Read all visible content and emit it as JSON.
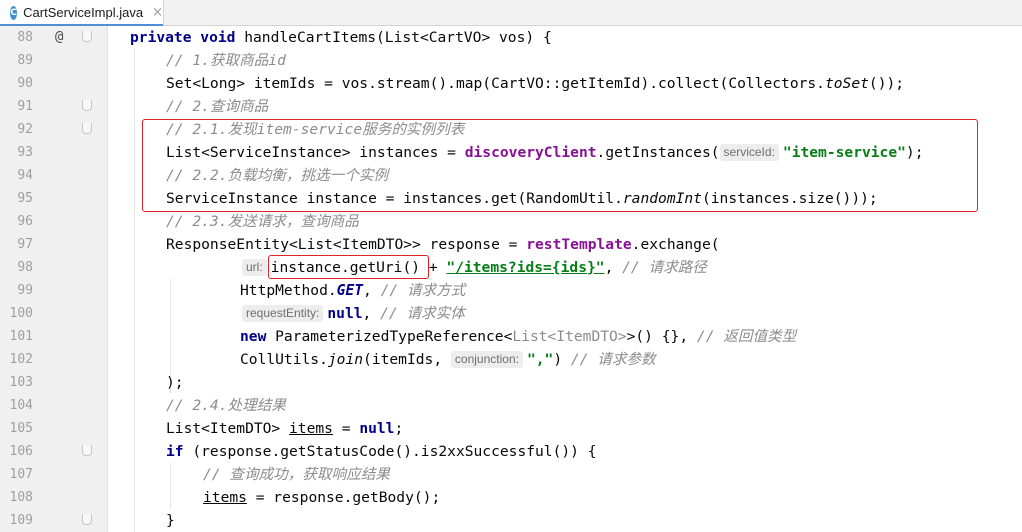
{
  "tab": {
    "icon": "C",
    "filename": "CartServiceImpl.java",
    "close": "×"
  },
  "gutter_marks": {
    "override": "@"
  },
  "hints": {
    "serviceId": "serviceId:",
    "url": "url:",
    "requestEntity": "requestEntity:",
    "conjunction": "conjunction:"
  },
  "lines": [
    {
      "num": "88"
    },
    {
      "num": "89"
    },
    {
      "num": "90"
    },
    {
      "num": "91"
    },
    {
      "num": "92"
    },
    {
      "num": "93"
    },
    {
      "num": "94"
    },
    {
      "num": "95"
    },
    {
      "num": "96"
    },
    {
      "num": "97"
    },
    {
      "num": "98"
    },
    {
      "num": "99"
    },
    {
      "num": "100"
    },
    {
      "num": "101"
    },
    {
      "num": "102"
    },
    {
      "num": "103"
    },
    {
      "num": "104"
    },
    {
      "num": "105"
    },
    {
      "num": "106"
    },
    {
      "num": "107"
    },
    {
      "num": "108"
    },
    {
      "num": "109"
    }
  ],
  "code": {
    "l88": {
      "kw1": "private void",
      "rest": " handleCartItems(List<CartVO> vos) {"
    },
    "l89": {
      "comment": "// 1.获取商品id"
    },
    "l90": {
      "a": "Set<Long> itemIds = vos.stream().map(CartVO::getItemId).collect(Collectors.",
      "it": "toSet",
      "b": "());"
    },
    "l91": {
      "comment": "// 2.查询商品"
    },
    "l92": {
      "comment": "// 2.1.发现item-service服务的实例列表"
    },
    "l93": {
      "a": "List<ServiceInstance> instances = ",
      "field": "discoveryClient",
      "b": ".getInstances(",
      "str": "\"item-service\"",
      "c": ");"
    },
    "l94": {
      "comment": "// 2.2.负载均衡，挑选一个实例"
    },
    "l95": {
      "a": "ServiceInstance instance = instances.get(RandomUtil.",
      "it": "randomInt",
      "b": "(instances.size()));"
    },
    "l96": {
      "comment": "// 2.3.发送请求，查询商品"
    },
    "l97": {
      "a": "ResponseEntity<List<ItemDTO>> response = ",
      "field": "restTemplate",
      "b": ".exchange("
    },
    "l98": {
      "a": "instance.getUri()",
      "b": " + ",
      "str": "\"/items?ids={ids}\"",
      "c": ", ",
      "comment": "// 请求路径"
    },
    "l99": {
      "a": "HttpMethod.",
      "it": "GET",
      "b": ", ",
      "comment": "// 请求方式"
    },
    "l100": {
      "kw": "null",
      "b": ", ",
      "comment": "// 请求实体"
    },
    "l101": {
      "kw": "new",
      "a": " ParameterizedTypeReference<",
      "grey": "List<ItemDTO>",
      "b": ">() {}, ",
      "comment": "// 返回值类型"
    },
    "l102": {
      "a": "CollUtils.",
      "it": "join",
      "b": "(itemIds, ",
      "str": "\",\"",
      "c": ") ",
      "comment": "// 请求参数"
    },
    "l103": {
      "a": ");"
    },
    "l104": {
      "comment": "// 2.4.处理结果"
    },
    "l105": {
      "a": "List<ItemDTO> ",
      "und": "items",
      "b": " = ",
      "kw": "null",
      "c": ";"
    },
    "l106": {
      "kw": "if",
      "a": " (response.getStatusCode().is2xxSuccessful()) {"
    },
    "l107": {
      "comment": "// 查询成功，获取响应结果"
    },
    "l108": {
      "und": "items",
      "a": " = response.getBody();"
    },
    "l109": {
      "a": "}"
    }
  }
}
